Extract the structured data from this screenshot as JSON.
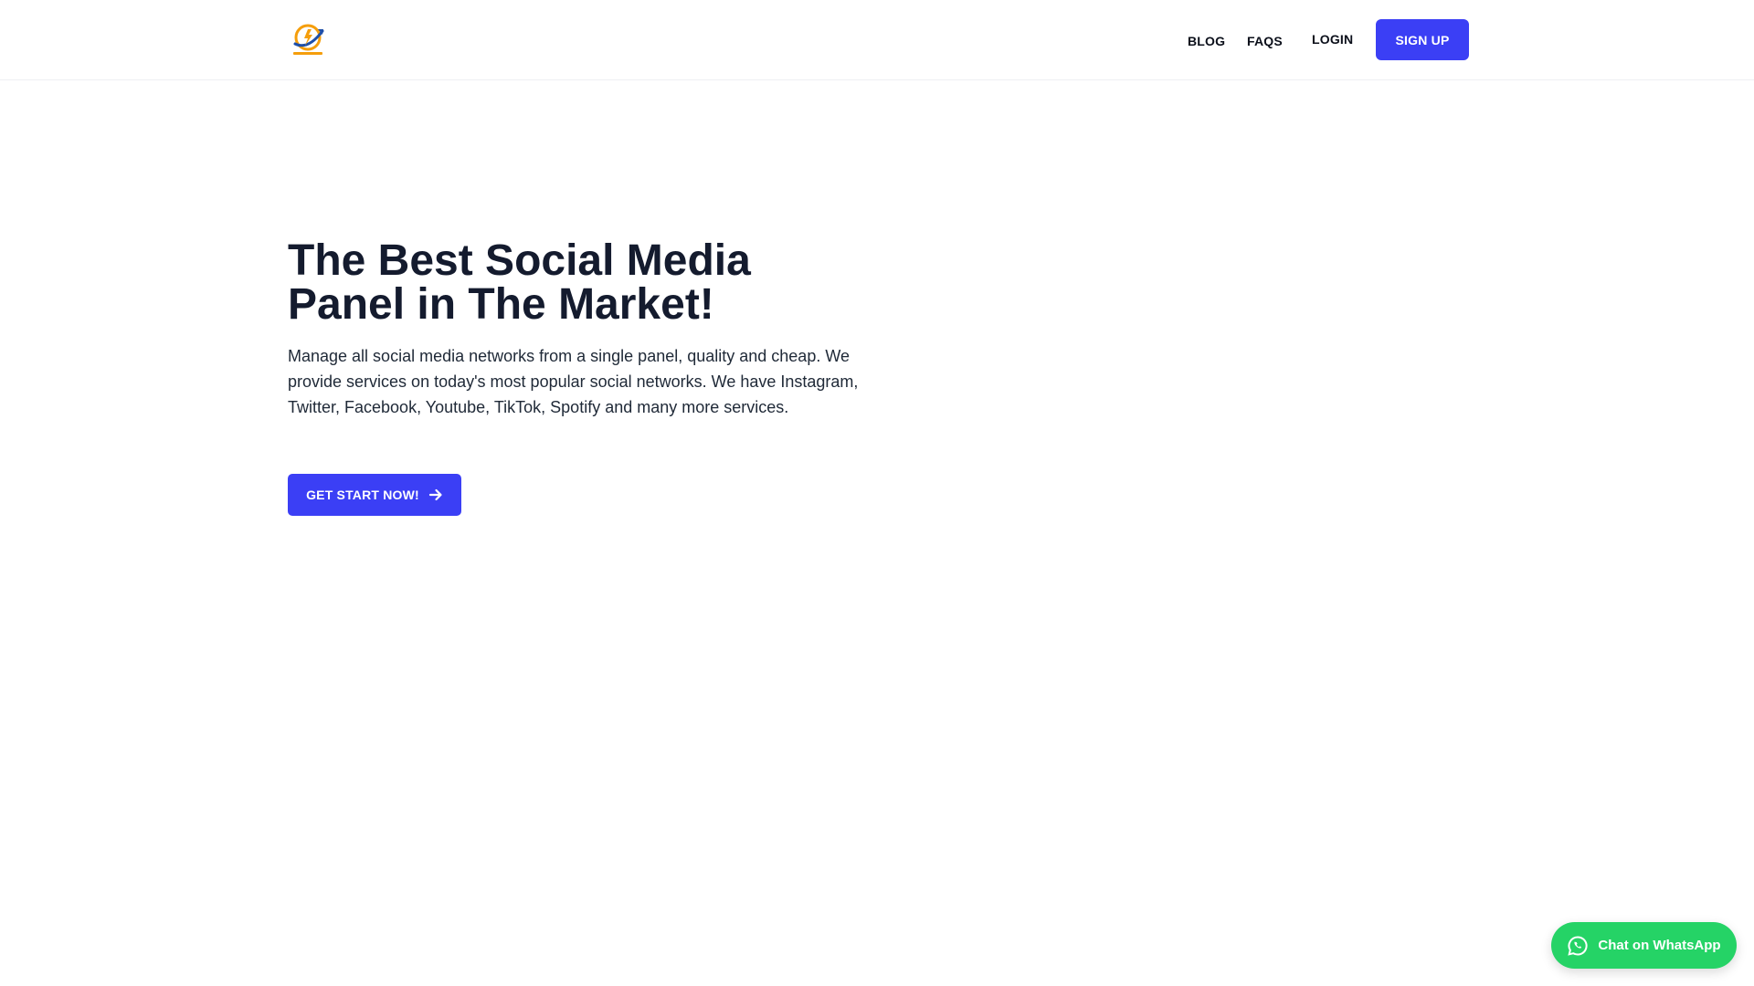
{
  "header": {
    "logo_icon": "brand-logo-icon",
    "nav": {
      "blog": "BLOG",
      "faqs": "FAQS",
      "login": "LOGIN",
      "signup": "SIGN UP"
    }
  },
  "hero": {
    "title": "The Best Social Media Panel in The Market!",
    "description": "Manage all social media networks from a single panel, quality and cheap. We provide services on today's most popular social networks. We have Instagram, Twitter, Facebook, Youtube, TikTok, Spotify and many more services.",
    "cta_label": "GET START NOW!",
    "cta_icon": "arrow-right-icon"
  },
  "whatsapp": {
    "label": "Chat on WhatsApp",
    "icon": "whatsapp-icon"
  },
  "colors": {
    "accent": "#3b3ff5",
    "whatsapp": "#25d366",
    "heading": "#141b2e"
  }
}
